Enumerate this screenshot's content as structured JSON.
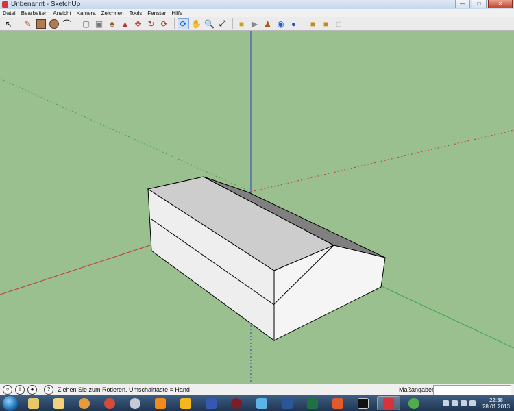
{
  "window": {
    "title": "Unbenannt - SketchUp",
    "minimize_icon": "minimize-icon",
    "maximize_icon": "maximize-icon",
    "close_icon": "close-icon"
  },
  "menu": [
    "Datei",
    "Bearbeiten",
    "Ansicht",
    "Kamera",
    "Zeichnen",
    "Tools",
    "Fenster",
    "Hilfe"
  ],
  "toolbar": {
    "groups": [
      [
        "select-icon"
      ],
      [
        "pencil-icon",
        "rectangle-icon",
        "circle-icon",
        "arc-icon"
      ],
      [
        "eraser-icon",
        "make-component-icon",
        "paint-bucket-icon",
        "push-pull-icon",
        "move-icon",
        "rotate-icon",
        "follow-me-icon"
      ],
      [
        "orbit-icon",
        "pan-icon",
        "zoom-icon",
        "zoom-extents-icon"
      ],
      [
        "tape-measure-icon",
        "text-icon",
        "walk-icon",
        "look-around-icon",
        "position-camera-icon"
      ],
      [
        "get-models-icon",
        "share-model-icon",
        "extension-icon"
      ]
    ]
  },
  "status": {
    "text": "Ziehen Sie zum Rotieren.  Umschalttaste = Hand",
    "measurements_label": "Maßangaben",
    "measurements_value": ""
  },
  "taskbar": {
    "apps": [
      "explorer",
      "folder",
      "media",
      "chrome",
      "dvd",
      "vlc",
      "app",
      "powerdvd",
      "recorder",
      "ie",
      "word",
      "excel",
      "fox",
      "cmd",
      "sketchup",
      "app2"
    ],
    "active_app": "sketchup",
    "clock_time": "22:38",
    "clock_date": "28.01.2013"
  },
  "colors": {
    "sky": "#9ac08f",
    "accent_red": "#d6333a"
  }
}
